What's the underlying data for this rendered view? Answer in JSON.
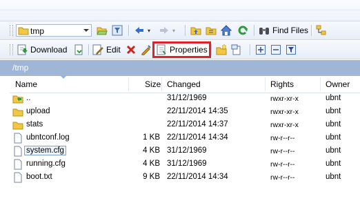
{
  "toolbar1": {
    "location": "tmp",
    "find_files_label": "Find Files"
  },
  "toolbar2": {
    "download_label": "Download",
    "edit_label": "Edit",
    "properties_label": "Properties"
  },
  "path": "/tmp",
  "columns": {
    "name": "Name",
    "size": "Size",
    "changed": "Changed",
    "rights": "Rights",
    "owner": "Owner"
  },
  "files": [
    {
      "name": "..",
      "size": "",
      "changed": "31/12/1969",
      "rights": "rwxr-xr-x",
      "owner": "ubnt",
      "icon": "parent-folder-icon"
    },
    {
      "name": "upload",
      "size": "",
      "changed": "22/11/2014 14:35",
      "rights": "rwxr-xr-x",
      "owner": "ubnt",
      "icon": "folder-icon"
    },
    {
      "name": "stats",
      "size": "",
      "changed": "22/11/2014 14:37",
      "rights": "rwxr-xr-x",
      "owner": "ubnt",
      "icon": "folder-icon"
    },
    {
      "name": "ubntconf.log",
      "size": "1 KB",
      "changed": "22/11/2014 14:34",
      "rights": "rw-r--r--",
      "owner": "ubnt",
      "icon": "file-icon"
    },
    {
      "name": "system.cfg",
      "size": "4 KB",
      "changed": "31/12/1969",
      "rights": "rw-r--r--",
      "owner": "ubnt",
      "icon": "file-icon"
    },
    {
      "name": "running.cfg",
      "size": "4 KB",
      "changed": "31/12/1969",
      "rights": "rw-r--r--",
      "owner": "ubnt",
      "icon": "file-icon"
    },
    {
      "name": "boot.txt",
      "size": "9 KB",
      "changed": "22/11/2014 14:34",
      "rights": "rw-r--r--",
      "owner": "ubnt",
      "icon": "file-icon"
    }
  ],
  "colors": {
    "pathbar": "#9fb6d6",
    "highlight": "#e0202a",
    "folder": "#f2c744"
  }
}
